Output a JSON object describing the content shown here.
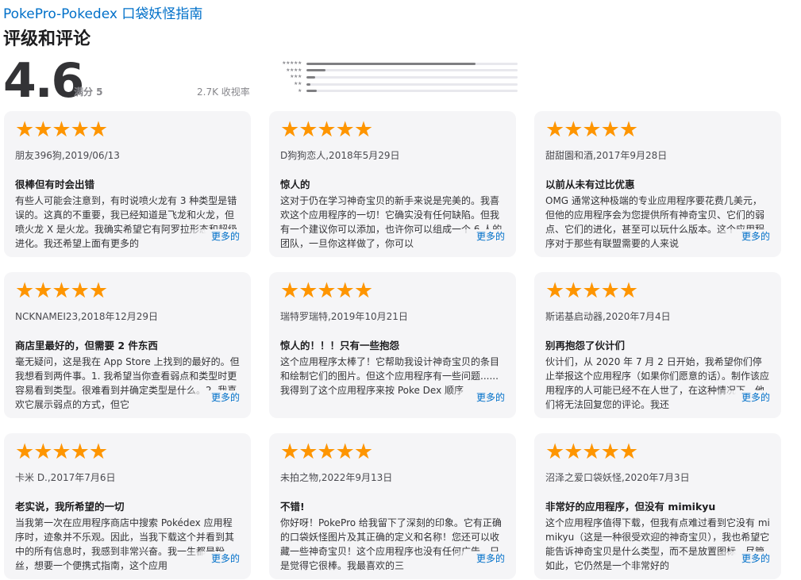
{
  "app": {
    "name": "PokePro-Pokedex 口袋妖怪指南"
  },
  "section": {
    "title": "评级和评论"
  },
  "rating": {
    "average": "4.6",
    "out_of": "满分 5",
    "count": "2.7K 收视率"
  },
  "histogram": [
    {
      "stars": 5,
      "glyphs": "★★★★★",
      "fraction": 0.8
    },
    {
      "stars": 4,
      "glyphs": "★★★★",
      "fraction": 0.09
    },
    {
      "stars": 3,
      "glyphs": "★★★",
      "fraction": 0.04
    },
    {
      "stars": 2,
      "glyphs": "★★",
      "fraction": 0.02
    },
    {
      "stars": 1,
      "glyphs": "★",
      "fraction": 0.05
    }
  ],
  "more_label": "更多的",
  "colors": {
    "link": "#0070c9",
    "star": "#fe9500",
    "card_bg": "#f5f5f7"
  },
  "reviews": [
    {
      "stars": "★★★★★",
      "rating": 5,
      "author_date": "朋友396狗,2019/06/13",
      "title": "很棒但有时会出错",
      "body": "有些人可能会注意到，有时说喷火龙有 3 种类型是错误的。这真的不重要，我已经知道是飞龙和火龙，但喷火龙 X 是火龙。我确实希望它有阿罗拉形态和超级进化。我还希望上面有更多的"
    },
    {
      "stars": "★★★★★",
      "rating": 5,
      "author_date": "D狗狗恋人,2018年5月29日",
      "title": "惊人的",
      "body": "这对于仍在学习神奇宝贝的新手来说是完美的。我喜欢这个应用程序的一切！它确实没有任何缺陷。但我有一个建议你可以添加，也许你可以组成一个 6 人的团队，一旦你这样做了，你可以"
    },
    {
      "stars": "★★★★★",
      "rating": 5,
      "author_date": "甜甜園和酒,2017年9月28日",
      "title": "以前从未有过比优惠",
      "body": "OMG 通常这种极端的专业应用程序要花费几美元，但他的应用程序会为您提供所有神奇宝贝、它们的弱点、它们的进化，甚至可以玩什么版本。这个应用程序对于那些有联盟需要的人来说"
    },
    {
      "stars": "★★★★★",
      "rating": 5,
      "author_date": "NCKNAMEI23,2018年12月29日",
      "title": "商店里最好的，但需要 2 件东西",
      "body": "毫无疑问，这是我在 App Store 上找到的最好的。但我想看到两件事。1. 我希望当你查看弱点和类型时更容易看到类型。很难看到并确定类型是什么。2. 我喜欢它展示弱点的方式，但它"
    },
    {
      "stars": "★★★★★",
      "rating": 5,
      "author_date": "瑞特罗瑞特,2019年10月21日",
      "title": "惊人的！！！只有一些抱怨",
      "body": "这个应用程序太棒了！它帮助我设计神奇宝贝的条目和绘制它们的图片。但这个应用程序有一些问题......\n我得到了这个应用程序来按 Poke Dex 顺序"
    },
    {
      "stars": "★★★★★",
      "rating": 5,
      "author_date": "斯诺基启动器,2020年7月4日",
      "title": "别再抱怨了伙计们",
      "body": "伙计们，从 2020 年 7 月 2 日开始，我希望你们停止举报这个应用程序（如果你们愿意的话）。制作该应用程序的人可能已经不在人世了，在这种情况下，他们将无法回复您的评论。我还"
    },
    {
      "stars": "★★★★★",
      "rating": 5,
      "author_date": "卡米 D.,2017年7月6日",
      "title": "老实说，我所希望的一切",
      "body": "当我第一次在应用程序商店中搜索 Pokédex 应用程序时，迹象并不乐观。因此，当我下载这个并看到其中的所有信息时，我感到非常兴奋。我一生都是粉丝，想要一个便携式指南，这个应用"
    },
    {
      "stars": "★★★★★",
      "rating": 5,
      "author_date": "未拍之物,2022年9月13日",
      "title": "不错!",
      "body": "你好呀！PokePro 给我留下了深刻的印象。它有正确的口袋妖怪图片及其正确的定义和名称！您还可以收藏一些神奇宝贝！这个应用程序也没有任何广告，只是觉得它很棒。我最喜欢的三"
    },
    {
      "stars": "★★★★★",
      "rating": 5,
      "author_date": "沼泽之爱口袋妖怪,2020年7月3日",
      "title": "非常好的应用程序，但没有 mimikyu",
      "body": "这个应用程序值得下载，但我有点难过看到它没有 mimikyu（这是一种很受欢迎的神奇宝贝），我也希望它能告诉神奇宝贝是什么类型，而不是放置图标。尽管如此，它仍然是一个非常好的"
    }
  ]
}
